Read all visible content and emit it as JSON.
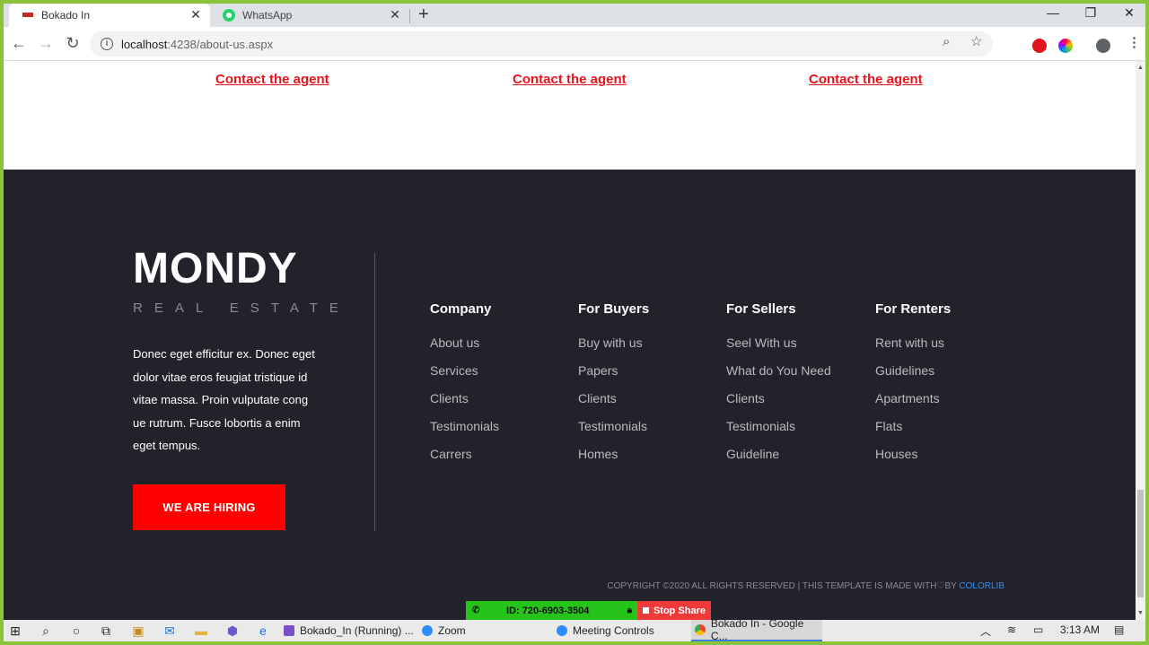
{
  "browser": {
    "tabs": [
      {
        "title": "Bokado In",
        "active": true
      },
      {
        "title": "WhatsApp",
        "active": false
      }
    ],
    "url_host": "localhost",
    "url_path": ":4238/about-us.aspx",
    "window_controls": {
      "minimize": "—",
      "restore": "❐",
      "close": "✕"
    }
  },
  "page": {
    "contact_links": [
      "Contact the agent",
      "Contact the agent",
      "Contact the agent"
    ],
    "footer": {
      "logo_main": "MONDY",
      "logo_sub": "REAL ESTATE",
      "about": "Donec eget efficitur ex. Donec eget dolor vitae eros feugiat tristique id vitae massa. Proin vulputate cong ue rutrum. Fusce lobortis a enim eget tempus.",
      "hire_button": "WE ARE HIRING",
      "columns": [
        {
          "heading": "Company",
          "links": [
            "About us",
            "Services",
            "Clients",
            "Testimonials",
            "Carrers"
          ]
        },
        {
          "heading": "For Buyers",
          "links": [
            "Buy with us",
            "Papers",
            "Clients",
            "Testimonials",
            "Homes"
          ]
        },
        {
          "heading": "For Sellers",
          "links": [
            "Seel With us",
            "What do You Need",
            "Clients",
            "Testimonials",
            "Guideline"
          ]
        },
        {
          "heading": "For Renters",
          "links": [
            "Rent with us",
            "Guidelines",
            "Apartments",
            "Flats",
            "Houses"
          ]
        }
      ],
      "copyright_prefix": "COPYRIGHT ©2020 ALL RIGHTS RESERVED | THIS TEMPLATE IS MADE WITH",
      "copyright_by": "BY",
      "copyright_brand": "COLORLIB"
    }
  },
  "zoom": {
    "meeting_id": "ID: 720-6903-3504",
    "stop_share": "Stop Share"
  },
  "taskbar": {
    "apps": [
      {
        "label": "Bokado_In (Running) ...",
        "color": "#7b4fc9"
      },
      {
        "label": "Zoom",
        "color": "#2d8cff"
      },
      {
        "label": "Meeting Controls",
        "color": "#2d8cff"
      },
      {
        "label": "Bokado In - Google C...",
        "color": "#e8a33a"
      }
    ],
    "clock": "3:13 AM"
  },
  "colors": {
    "accent_red": "#ff0000",
    "link_red": "#e8141c",
    "footer_bg": "#22232a",
    "zoom_green": "#26c31a"
  }
}
